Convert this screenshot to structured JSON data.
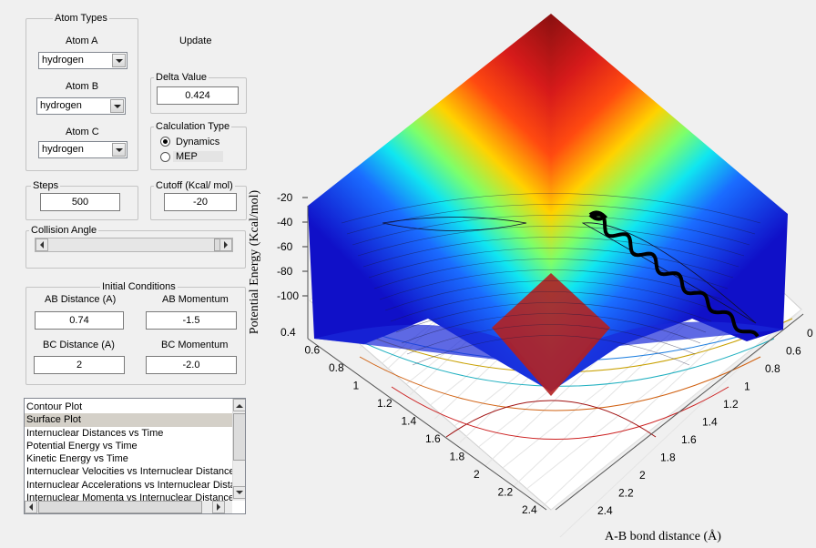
{
  "atom_types": {
    "title": "Atom Types",
    "atom_a": {
      "label": "Atom A",
      "value": "hydrogen"
    },
    "atom_b": {
      "label": "Atom B",
      "value": "hydrogen"
    },
    "atom_c": {
      "label": "Atom C",
      "value": "hydrogen"
    }
  },
  "update_label": "Update",
  "delta": {
    "label": "Delta Value",
    "value": "0.424"
  },
  "calc_type": {
    "title": "Calculation Type",
    "options": [
      "Dynamics",
      "MEP"
    ],
    "selected": "Dynamics"
  },
  "steps": {
    "label": "Steps",
    "value": "500"
  },
  "cutoff": {
    "label": "Cutoff (Kcal/ mol)",
    "value": "-20"
  },
  "collision_angle": {
    "label": "Collision Angle"
  },
  "initial_conditions": {
    "title": "Initial Conditions",
    "ab_distance": {
      "label": "AB Distance (A)",
      "value": "0.74"
    },
    "ab_momentum": {
      "label": "AB Momentum",
      "value": "-1.5"
    },
    "bc_distance": {
      "label": "BC Distance (A)",
      "value": "2"
    },
    "bc_momentum": {
      "label": "BC Momentum",
      "value": "-2.0"
    }
  },
  "plot_list": {
    "items": [
      "Contour Plot",
      "Surface Plot",
      "Internuclear Distances vs Time",
      "Potential Energy vs Time",
      "Kinetic Energy vs Time",
      "Internuclear Velocities vs Internuclear Distance",
      "Internuclear Accelerations vs Internuclear Distance",
      "Internuclear Momenta vs Internuclear Distance"
    ],
    "selected": "Surface Plot"
  },
  "plot": {
    "zlabel": "Potential Energy (Kcal/mol)",
    "xlabel": "A-B bond distance (Å)",
    "z_ticks": [
      "-20",
      "-40",
      "-60",
      "-80",
      "-100"
    ],
    "left_ticks": [
      "0.4",
      "0.6",
      "0.8",
      "1",
      "1.2",
      "1.4",
      "1.6",
      "1.8",
      "2",
      "2.2",
      "2.4"
    ],
    "right_ticks": [
      "0",
      "0.6",
      "0.8",
      "1",
      "1.2",
      "1.4",
      "1.6",
      "1.8",
      "2",
      "2.2",
      "2.4"
    ]
  },
  "chart_data": {
    "type": "surface",
    "title": "",
    "xlabel": "A-B bond distance (Å)",
    "ylabel": "",
    "zlabel": "Potential Energy (Kcal/mol)",
    "z_ticks": [
      -20,
      -40,
      -60,
      -80,
      -100
    ],
    "x_ticks": [
      0.4,
      0.6,
      0.8,
      1,
      1.2,
      1.4,
      1.6,
      1.8,
      2,
      2.2,
      2.4
    ],
    "y_ticks": [
      0.6,
      0.8,
      1,
      1.2,
      1.4,
      1.6,
      1.8,
      2,
      2.2,
      2.4
    ],
    "colormap": "jet",
    "trajectory_color": "#000000"
  }
}
